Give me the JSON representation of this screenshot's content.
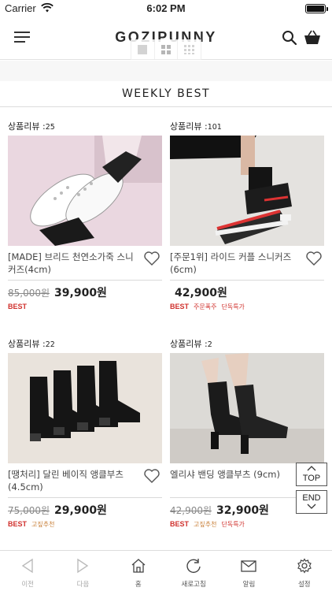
{
  "status_bar": {
    "carrier": "Carrier",
    "time": "6:02 PM"
  },
  "header": {
    "logo": "GOZIPUNNY"
  },
  "section": {
    "title": "WEEKLY BEST"
  },
  "products": [
    {
      "review_label": "상품리뷰 :",
      "review_count": "25",
      "name": "[MADE] 브리드 천연소가죽 스니커즈(4cm)",
      "old_price": "85,000원",
      "price": "39,900원",
      "badges": [
        {
          "text": "BEST",
          "style": "best"
        }
      ]
    },
    {
      "review_label": "상품리뷰 :",
      "review_count": "101",
      "name": "[주문1위] 라이드 커플 스니커즈 (6cm)",
      "old_price": "",
      "price": "42,900원",
      "badges": [
        {
          "text": "BEST",
          "style": "best"
        },
        {
          "text": "주문폭주",
          "style": "red"
        },
        {
          "text": "단독특가",
          "style": "red"
        }
      ]
    },
    {
      "review_label": "상품리뷰 :",
      "review_count": "22",
      "name": "[땡처리] 달린 베이직 앵클부츠 (4.5cm)",
      "old_price": "75,000원",
      "price": "29,900원",
      "badges": [
        {
          "text": "BEST",
          "style": "best"
        },
        {
          "text": "고짚추천",
          "style": "orange"
        }
      ]
    },
    {
      "review_label": "상품리뷰 :",
      "review_count": "2",
      "name": "엘리샤 밴딩 앵클부츠 (9cm)",
      "old_price": "42,900원",
      "price": "32,900원",
      "badges": [
        {
          "text": "BEST",
          "style": "best"
        },
        {
          "text": "고짚추천",
          "style": "orange"
        },
        {
          "text": "단독특가",
          "style": "red"
        }
      ]
    }
  ],
  "float_buttons": {
    "top": "TOP",
    "end": "END"
  },
  "tabbar": [
    {
      "label": "이전",
      "icon": "back-arrow-icon"
    },
    {
      "label": "다음",
      "icon": "forward-arrow-icon"
    },
    {
      "label": "홈",
      "icon": "home-icon"
    },
    {
      "label": "새로고침",
      "icon": "refresh-icon"
    },
    {
      "label": "알림",
      "icon": "mail-icon"
    },
    {
      "label": "설정",
      "icon": "gear-icon"
    }
  ],
  "colors": {
    "accent_red": "#d0312d",
    "accent_orange": "#c9803a",
    "divider": "#dcdcdc"
  }
}
